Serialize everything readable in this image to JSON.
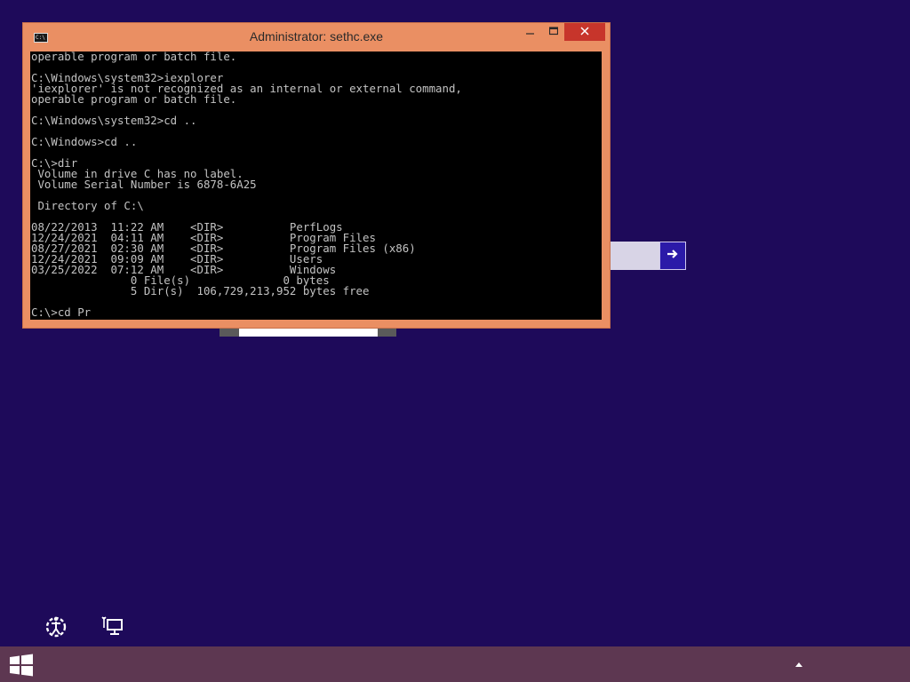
{
  "window": {
    "title": "Administrator: sethc.exe",
    "icon_label": "C:\\",
    "icons": {
      "minimize": "minimize-icon",
      "maximize": "maximize-icon",
      "close": "close-icon"
    }
  },
  "console": {
    "text": "operable program or batch file.\n\nC:\\Windows\\system32>iexplorer\n'iexplorer' is not recognized as an internal or external command,\noperable program or batch file.\n\nC:\\Windows\\system32>cd ..\n\nC:\\Windows>cd ..\n\nC:\\>dir\n Volume in drive C has no label.\n Volume Serial Number is 6878-6A25\n\n Directory of C:\\\n\n08/22/2013  11:22 AM    <DIR>          PerfLogs\n12/24/2021  04:11 AM    <DIR>          Program Files\n08/27/2021  02:30 AM    <DIR>          Program Files (x86)\n12/24/2021  09:09 AM    <DIR>          Users\n03/25/2022  07:12 AM    <DIR>          Windows\n               0 File(s)              0 bytes\n               5 Dir(s)  106,729,213,952 bytes free\n\nC:\\>cd Pr"
  },
  "login": {
    "password_value": "",
    "submit_icon": "arrow-right-icon"
  },
  "bottom": {
    "ease_of_access_icon": "ease-of-access-icon",
    "network_icon": "network-icon"
  },
  "taskbar": {
    "start_icon": "windows-logo-icon",
    "tray_icon": "chevron-up-icon"
  },
  "colors": {
    "desktop": "#1e0a5a",
    "window_frame": "#ea8f63",
    "close_button": "#c7352b",
    "taskbar": "#5d3751",
    "submit_button": "#2b1aa8"
  }
}
